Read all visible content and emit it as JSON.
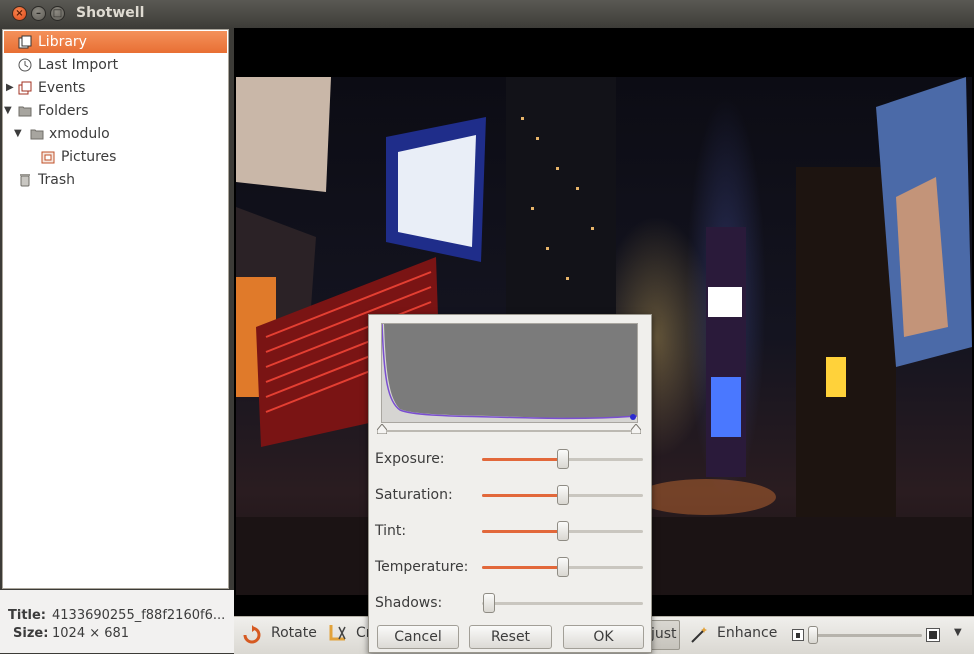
{
  "window": {
    "title": "Shotwell"
  },
  "sidebar": {
    "items": [
      {
        "label": "Library"
      },
      {
        "label": "Last Import"
      },
      {
        "label": "Events"
      },
      {
        "label": "Folders"
      },
      {
        "label": "xmodulo"
      },
      {
        "label": "Pictures"
      },
      {
        "label": "Trash"
      }
    ]
  },
  "info": {
    "title_key": "Title:",
    "title_value": "4133690255_f88f2160f6...",
    "size_key": "Size:",
    "size_value": "1024 × 681"
  },
  "toolbar": {
    "rotate": "Rotate",
    "crop_partial": "Cr",
    "adjust_partial": "just",
    "enhance": "Enhance"
  },
  "adjust_dialog": {
    "sliders": [
      {
        "label": "Exposure:",
        "value": 0.5
      },
      {
        "label": "Saturation:",
        "value": 0.5
      },
      {
        "label": "Tint:",
        "value": 0.5
      },
      {
        "label": "Temperature:",
        "value": 0.5
      },
      {
        "label": "Shadows:",
        "value": 0.0
      }
    ],
    "buttons": {
      "cancel": "Cancel",
      "reset": "Reset",
      "ok": "OK"
    }
  },
  "colors": {
    "accent": "#e86f34",
    "titlebar": "#3d3c38"
  }
}
